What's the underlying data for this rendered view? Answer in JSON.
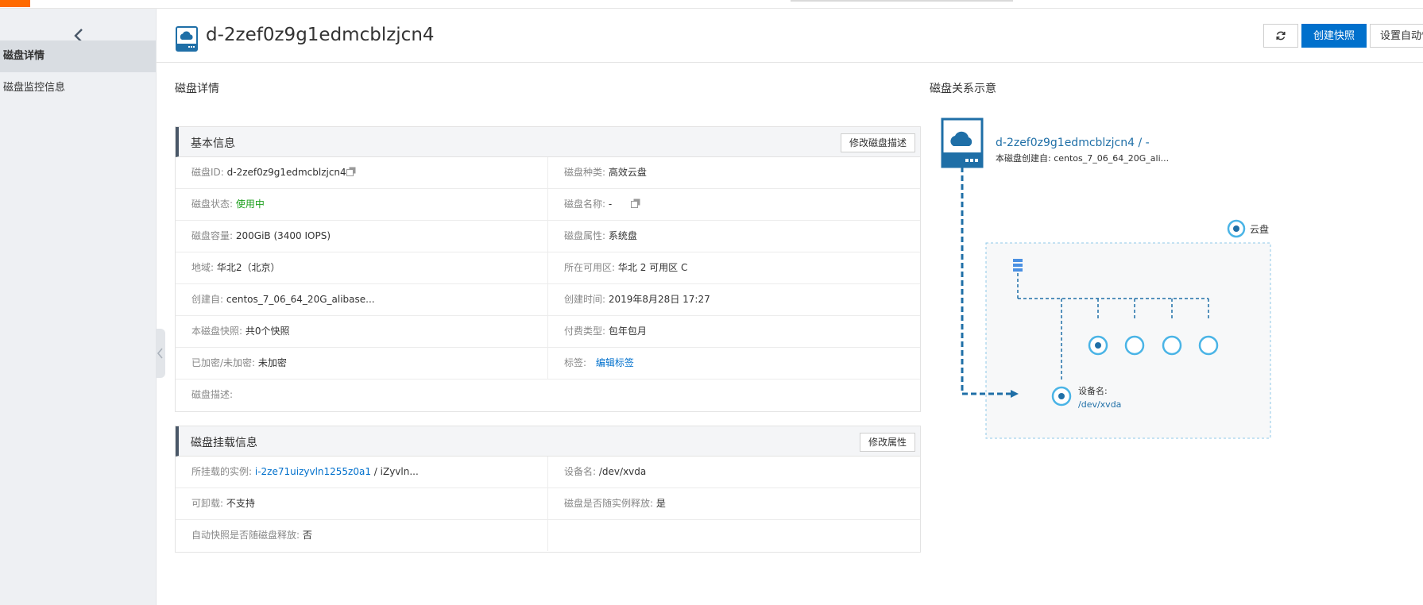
{
  "sidebar": {
    "items": [
      {
        "label": "磁盘详情",
        "active": true
      },
      {
        "label": "磁盘监控信息",
        "active": false
      }
    ]
  },
  "header": {
    "title": "d-2zef0z9g1edmcblzjcn4",
    "create_snapshot_label": "创建快照",
    "auto_snapshot_label": "设置自动快照策略"
  },
  "details_heading": "磁盘详情",
  "relation_heading": "磁盘关系示意",
  "basic_info": {
    "title": "基本信息",
    "edit_label": "修改磁盘描述",
    "disk_id_key": "磁盘ID:",
    "disk_id_value": "d-2zef0z9g1edmcblzjcn4",
    "disk_type_key": "磁盘种类:",
    "disk_type_value": "高效云盘",
    "status_key": "磁盘状态:",
    "status_value": "使用中",
    "name_key": "磁盘名称:",
    "name_value": "-",
    "capacity_key": "磁盘容量:",
    "capacity_value": "200GiB (3400 IOPS)",
    "attribute_key": "磁盘属性:",
    "attribute_value": "系统盘",
    "region_key": "地域:",
    "region_value": "华北2（北京）",
    "zone_key": "所在可用区:",
    "zone_value": "华北 2 可用区 C",
    "created_from_key": "创建自:",
    "created_from_value": "centos_7_06_64_20G_alibase...",
    "created_time_key": "创建时间:",
    "created_time_value": "2019年8月28日 17:27",
    "snapshots_key": "本磁盘快照:",
    "snapshots_value": "共0个快照",
    "billing_key": "付费类型:",
    "billing_value": "包年包月",
    "encryption_key": "已加密/未加密:",
    "encryption_value": "未加密",
    "tags_key": "标签:",
    "tags_value": "编辑标签",
    "description_key": "磁盘描述:"
  },
  "mount_info": {
    "title": "磁盘挂载信息",
    "edit_label": "修改属性",
    "instance_key": "所挂载的实例:",
    "instance_id": "i-2ze71uizyvln1255z0a1",
    "instance_name": " / iZyvln...",
    "device_key": "设备名:",
    "device_value": "/dev/xvda",
    "detachable_key": "可卸载:",
    "detachable_value": "不支持",
    "release_with_instance_key": "磁盘是否随实例释放:",
    "release_with_instance_value": "是",
    "auto_snapshot_release_key": "自动快照是否随磁盘释放:",
    "auto_snapshot_release_value": "否"
  },
  "diagram": {
    "disk_label": "d-2zef0z9g1edmcblzjcn4 / -",
    "created_from_line": "本磁盘创建自:   centos_7_06_64_20G_ali...",
    "cloud_disk_legend": "云盘",
    "device_name_label": "设备名:",
    "device_name_value": "/dev/xvda"
  },
  "colors": {
    "primary": "#0070cc",
    "brand": "#ff6a00",
    "diagram": "#1f6fa7",
    "status_green": "#1a9e1a"
  }
}
